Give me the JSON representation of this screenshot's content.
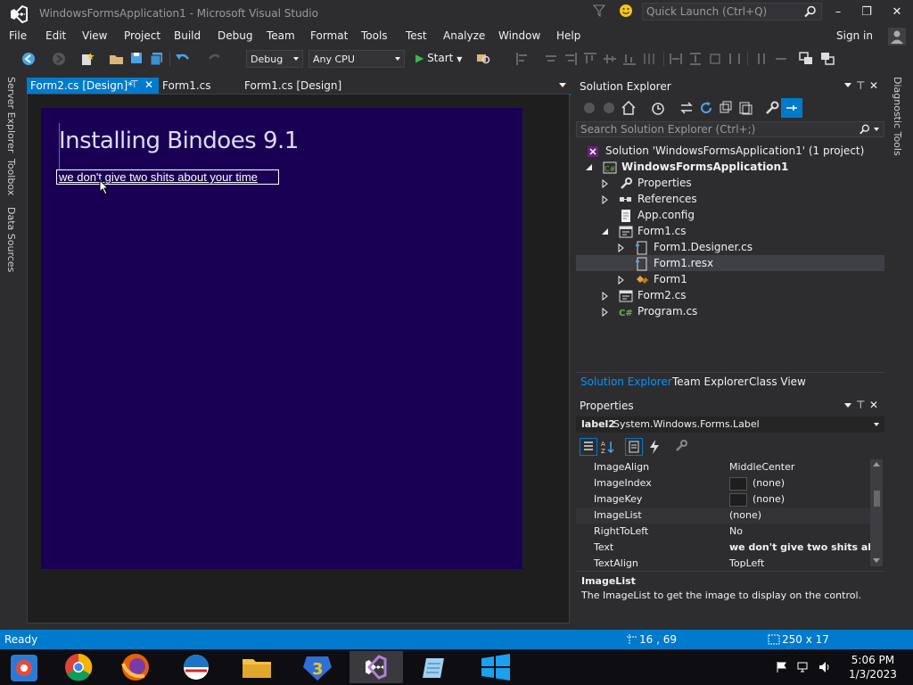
{
  "window": {
    "title": "WindowsFormsApplication1 - Microsoft Visual Studio"
  },
  "quick_launch": {
    "placeholder": "Quick Launch (Ctrl+Q)"
  },
  "menu": [
    "File",
    "Edit",
    "View",
    "Project",
    "Build",
    "Debug",
    "Team",
    "Format",
    "Tools",
    "Test",
    "Analyze",
    "Window",
    "Help"
  ],
  "account": {
    "signin": "Sign in"
  },
  "toolbar": {
    "config": "Debug",
    "platform": "Any CPU",
    "start": "Start"
  },
  "left_rail": [
    "Server Explorer",
    "Toolbox",
    "Data Sources"
  ],
  "right_rail": [
    "Diagnostic Tools"
  ],
  "doc_tabs": [
    {
      "label": "Form2.cs [Design]*",
      "active": true
    },
    {
      "label": "Form1.cs",
      "active": false
    },
    {
      "label": "Form1.cs [Design]",
      "active": false
    }
  ],
  "designer": {
    "title_text": "Installing Bindoes 9.1",
    "label2_text": "we don't give two shits about your time"
  },
  "solution_explorer": {
    "title": "Solution Explorer",
    "search_placeholder": "Search Solution Explorer (Ctrl+;)",
    "tree": [
      {
        "label": "Solution 'WindowsFormsApplication1' (1 project)",
        "icon": "solution-icon"
      },
      {
        "label": "WindowsFormsApplication1",
        "icon": "csharp-project-icon"
      },
      {
        "label": "Properties",
        "icon": "wrench-icon"
      },
      {
        "label": "References",
        "icon": "references-icon"
      },
      {
        "label": "App.config",
        "icon": "config-icon"
      },
      {
        "label": "Form1.cs",
        "icon": "form-icon"
      },
      {
        "label": "Form1.Designer.cs",
        "icon": "cs-file-icon"
      },
      {
        "label": "Form1.resx",
        "icon": "resx-icon"
      },
      {
        "label": "Form1",
        "icon": "class-icon"
      },
      {
        "label": "Form2.cs",
        "icon": "form-icon"
      },
      {
        "label": "Program.cs",
        "icon": "csharp-file-icon"
      }
    ],
    "bottom_tabs": [
      "Solution Explorer",
      "Team Explorer",
      "Class View"
    ]
  },
  "properties": {
    "title": "Properties",
    "object_name": "label2",
    "object_type": "System.Windows.Forms.Label",
    "rows": [
      {
        "name": "ImageAlign",
        "value": "MiddleCenter"
      },
      {
        "name": "ImageIndex",
        "value": "(none)"
      },
      {
        "name": "ImageKey",
        "value": "(none)"
      },
      {
        "name": "ImageList",
        "value": "(none)"
      },
      {
        "name": "RightToLeft",
        "value": "No"
      },
      {
        "name": "Text",
        "value": "we don't give two shits about yo"
      },
      {
        "name": "TextAlign",
        "value": "TopLeft"
      }
    ],
    "desc_title": "ImageList",
    "desc_text": "The ImageList to get the image to display on the control."
  },
  "status": {
    "text": "Ready",
    "position": "16 , 69",
    "size": "250 x 17"
  },
  "clock": {
    "time": "5:06 PM",
    "date": "1/3/2023"
  },
  "colors": {
    "accent": "#007acc",
    "form_bg": "#1a0055",
    "chrome": "#2d2d30"
  }
}
